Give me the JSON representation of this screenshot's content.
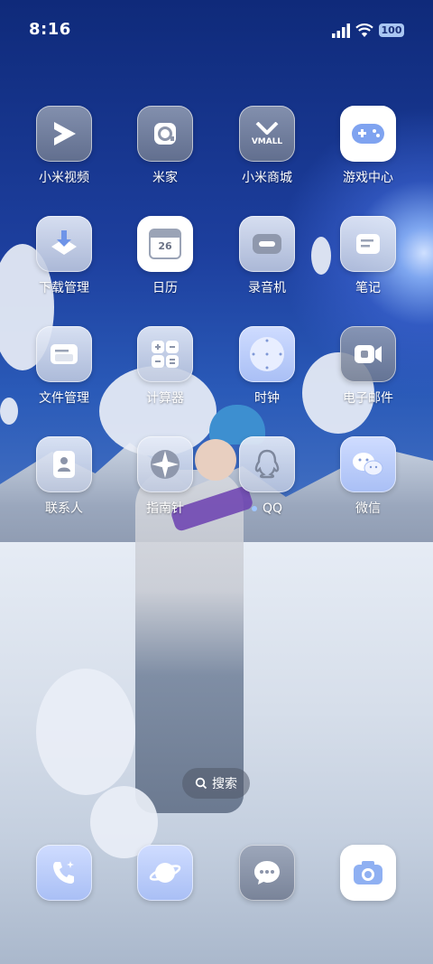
{
  "status_bar": {
    "time": "8:16",
    "battery_level": "100"
  },
  "apps": [
    {
      "label": "小米视频",
      "icon": "play-icon"
    },
    {
      "label": "米家",
      "icon": "mihome-icon"
    },
    {
      "label": "小米商城",
      "icon": "vmall-icon",
      "icon_text": "VMALL"
    },
    {
      "label": "游戏中心",
      "icon": "gamepad-icon"
    },
    {
      "label": "下载管理",
      "icon": "download-icon"
    },
    {
      "label": "日历",
      "icon": "calendar-icon",
      "icon_text": "26"
    },
    {
      "label": "录音机",
      "icon": "recorder-icon"
    },
    {
      "label": "笔记",
      "icon": "notes-icon"
    },
    {
      "label": "文件管理",
      "icon": "folder-icon"
    },
    {
      "label": "计算器",
      "icon": "calculator-icon"
    },
    {
      "label": "时钟",
      "icon": "clock-icon"
    },
    {
      "label": "电子邮件",
      "icon": "email-icon"
    },
    {
      "label": "联系人",
      "icon": "contacts-icon"
    },
    {
      "label": "指南针",
      "icon": "compass-icon"
    },
    {
      "label": "QQ",
      "icon": "qq-icon",
      "new_dot": true
    },
    {
      "label": "微信",
      "icon": "wechat-icon"
    }
  ],
  "search": {
    "label": "搜索"
  },
  "dock": [
    {
      "icon": "phone-icon"
    },
    {
      "icon": "browser-icon"
    },
    {
      "icon": "messages-icon"
    },
    {
      "icon": "camera-icon"
    }
  ]
}
